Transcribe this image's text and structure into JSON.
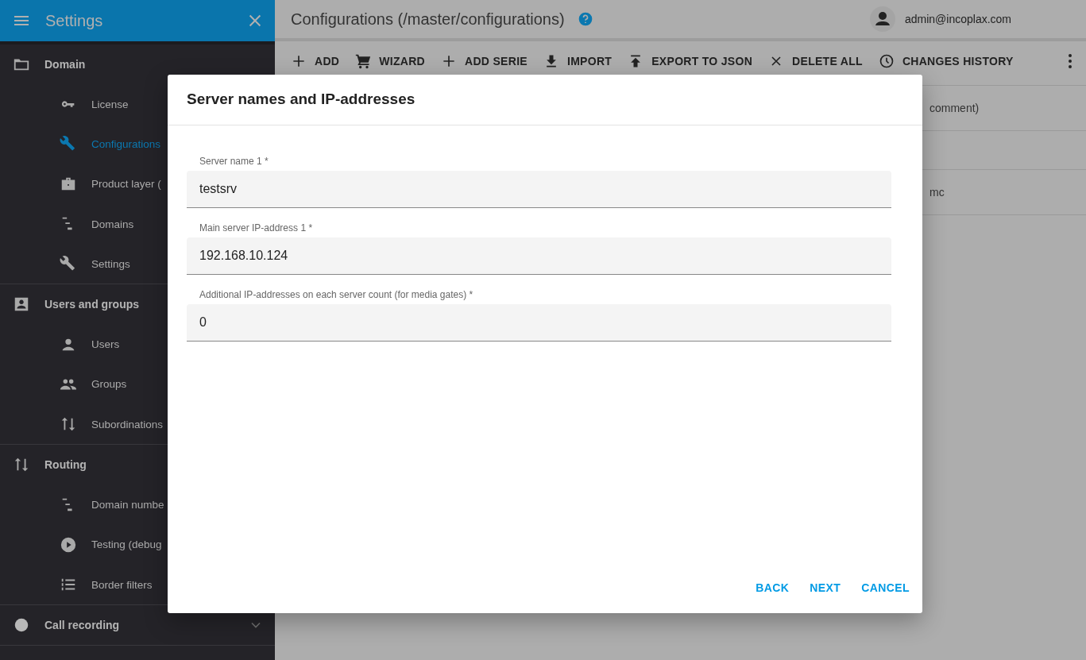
{
  "sidebar": {
    "title": "Settings",
    "groups": [
      {
        "label": "Domain",
        "expanded": true,
        "children": [
          {
            "label": "License",
            "selected": false
          },
          {
            "label": "Configurations",
            "selected": true
          },
          {
            "label": "Product layer (",
            "selected": false
          },
          {
            "label": "Domains",
            "selected": false
          },
          {
            "label": "Settings",
            "selected": false
          }
        ]
      },
      {
        "label": "Users and groups",
        "expanded": true,
        "children": [
          {
            "label": "Users",
            "selected": false
          },
          {
            "label": "Groups",
            "selected": false
          },
          {
            "label": "Subordinations",
            "selected": false
          }
        ]
      },
      {
        "label": "Routing",
        "expanded": true,
        "children": [
          {
            "label": "Domain numbe",
            "selected": false
          },
          {
            "label": "Testing (debug",
            "selected": false
          },
          {
            "label": "Border filters",
            "selected": false
          }
        ]
      },
      {
        "label": "Call recording",
        "expanded": false
      }
    ]
  },
  "header": {
    "title": "Configurations (/master/configurations)",
    "user": "admin@incoplax.com"
  },
  "toolbar": [
    "ADD",
    "WIZARD",
    "ADD SERIE",
    "IMPORT",
    "EXPORT TO JSON",
    "DELETE ALL",
    "CHANGES HISTORY"
  ],
  "table": {
    "rows": [
      "comment)",
      "",
      "mc"
    ]
  },
  "dialog": {
    "title": "Server names and IP-addresses",
    "fields": [
      {
        "label": "Server name 1 *",
        "value": "testsrv"
      },
      {
        "label": "Main server IP-address 1 *",
        "value": "192.168.10.124"
      },
      {
        "label": "Additional IP-addresses on each server count (for media gates) *",
        "value": "0"
      }
    ],
    "actions": [
      "BACK",
      "NEXT",
      "CANCEL"
    ]
  }
}
